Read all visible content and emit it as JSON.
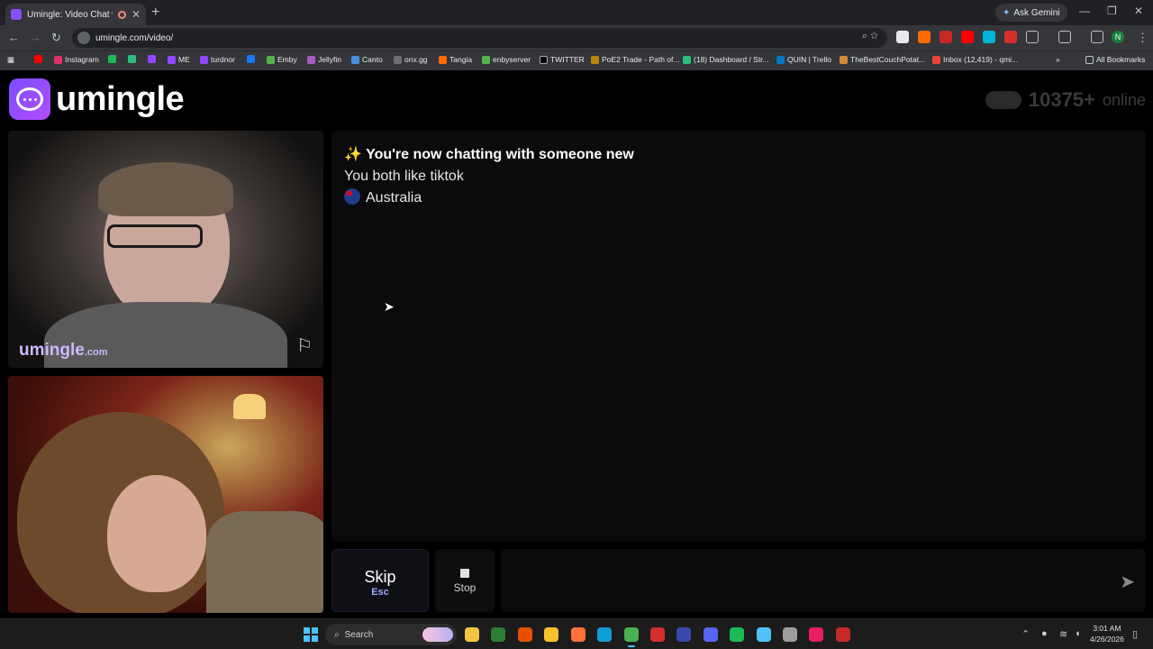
{
  "browser": {
    "tab_title": "Umingle: Video Chat with S",
    "tab_close": "✕",
    "new_tab": "+",
    "gemini_label": "Ask Gemini",
    "url": "umingle.com/video/",
    "window_controls": [
      "—",
      "❐",
      "✕"
    ],
    "bookmarks": [
      {
        "label": "",
        "color": "#ff0000"
      },
      {
        "label": "Instagram",
        "color": "#e1306c"
      },
      {
        "label": "",
        "color": "#1db954"
      },
      {
        "label": "",
        "color": "#2bbd7e"
      },
      {
        "label": "",
        "color": "#9146ff"
      },
      {
        "label": "ME",
        "color": "#9146ff"
      },
      {
        "label": "turdnor",
        "color": "#9146ff"
      },
      {
        "label": "",
        "color": "#1877f2"
      },
      {
        "label": "Emby",
        "color": "#52b54b"
      },
      {
        "label": "Jellyfin",
        "color": "#aa5cc3"
      },
      {
        "label": "Canto",
        "color": "#4a90d9"
      },
      {
        "label": "onx.gg",
        "color": "#6e6e6e"
      },
      {
        "label": "Tangia",
        "color": "#ff6a00"
      },
      {
        "label": "enbyserver",
        "color": "#52b54b"
      },
      {
        "label": "TWITTER",
        "color": "#000000"
      },
      {
        "label": "PoE2 Trade - Path of...",
        "color": "#b8860b"
      },
      {
        "label": "(18) Dashboard / Str...",
        "color": "#2bbd7e"
      },
      {
        "label": "QUIN | Trello",
        "color": "#0079bf"
      },
      {
        "label": "TheBestCouchPotat...",
        "color": "#d08a3a"
      },
      {
        "label": "Inbox (12,419) - qmi...",
        "color": "#ea4335"
      }
    ],
    "all_bookmarks": "All Bookmarks"
  },
  "page": {
    "logo_text": "umingle",
    "online_count": "10375+",
    "online_label": "online",
    "watermark": "umingle",
    "watermark_suffix": ".com",
    "chat": {
      "line1": "✨ You're now chatting with someone new",
      "line2": "You both like tiktok",
      "line3": "Australia"
    },
    "skip_label": "Skip",
    "skip_key": "Esc",
    "stop_label": "Stop",
    "send_icon": "➤"
  },
  "taskbar": {
    "search_label": "Search",
    "time": "3:01 AM",
    "date": "4/26/2026"
  }
}
